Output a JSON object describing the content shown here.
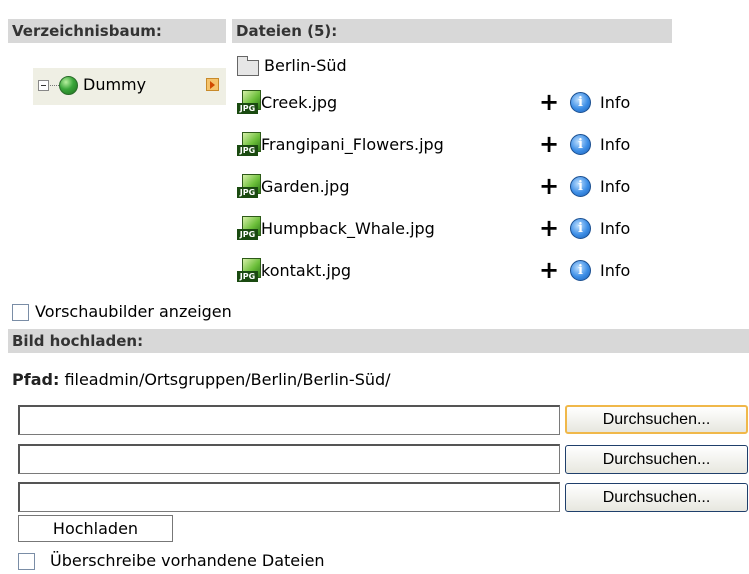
{
  "tree": {
    "header": "Verzeichnisbaum:",
    "node_label": "Dummy"
  },
  "files": {
    "header": "Dateien (5):",
    "folder": "Berlin-Süd",
    "items": [
      {
        "name": "Creek.jpg",
        "plus": "+",
        "info": "Info",
        "icon_text": "JPG"
      },
      {
        "name": "Frangipani_Flowers.jpg",
        "plus": "+",
        "info": "Info",
        "icon_text": "JPG"
      },
      {
        "name": "Garden.jpg",
        "plus": "+",
        "info": "Info",
        "icon_text": "JPG"
      },
      {
        "name": "Humpback_Whale.jpg",
        "plus": "+",
        "info": "Info",
        "icon_text": "JPG"
      },
      {
        "name": "kontakt.jpg",
        "plus": "+",
        "info": "Info",
        "icon_text": "JPG"
      }
    ]
  },
  "thumbnails_label": "Vorschaubilder anzeigen",
  "upload": {
    "header": "Bild hochladen:",
    "path_label": "Pfad:",
    "path_value": "fileadmin/Ortsgruppen/Berlin/Berlin-Süd/",
    "browse_label": "Durchsuchen...",
    "upload_button": "Hochladen",
    "overwrite_label": "Überschreibe vorhandene Dateien"
  },
  "colors": {
    "header_bg": "#d8d8d8",
    "tree_node_bg": "#efefe4",
    "focus_outline": "#f0b84a"
  }
}
